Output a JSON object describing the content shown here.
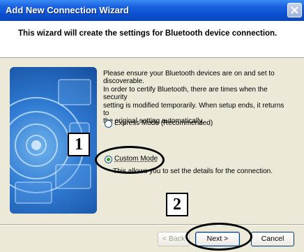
{
  "window": {
    "title": "Add New Connection Wizard"
  },
  "header": {
    "text": "This wizard will create the settings for Bluetooth device connection."
  },
  "message": {
    "lines": [
      "Please ensure your Bluetooth devices are on and set to",
      "discoverable.",
      "In order to certify Bluetooth, there are times when the security",
      "setting is modified temporarily. When setup ends, it returns to",
      "the original setting automatically."
    ]
  },
  "options": {
    "express_label": "Express Mode (Recommended)",
    "custom_label": "Custom Mode",
    "custom_description": "This allows you to set the details for the connection.",
    "selected": "custom"
  },
  "callouts": {
    "one": "1",
    "two": "2"
  },
  "buttons": {
    "back": "< Back",
    "next": "Next >",
    "cancel": "Cancel"
  },
  "colors": {
    "titlebar": "#0a4fd0",
    "dialog_bg": "#ece9d8",
    "radio_dot": "#21a121"
  }
}
